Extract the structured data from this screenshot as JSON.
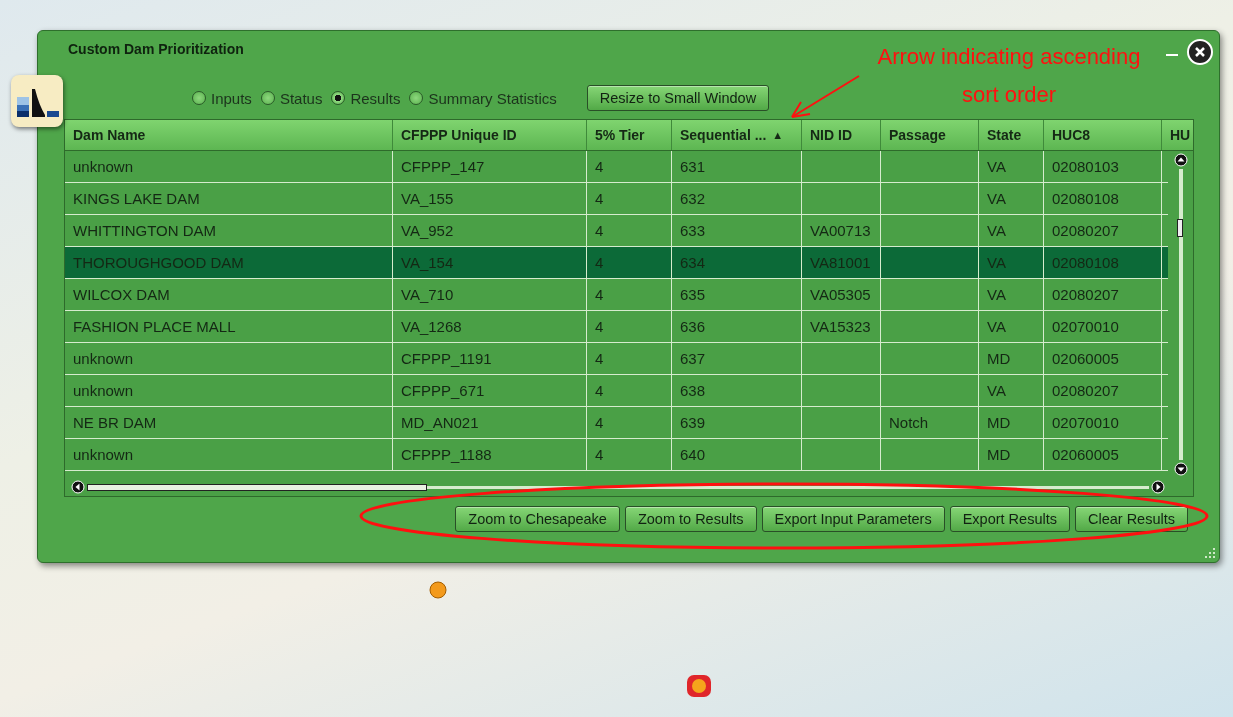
{
  "window": {
    "title": "Custom Dam Prioritization"
  },
  "views": [
    {
      "label": "Inputs",
      "selected": false
    },
    {
      "label": "Status",
      "selected": false
    },
    {
      "label": "Results",
      "selected": true
    },
    {
      "label": "Summary Statistics",
      "selected": false
    }
  ],
  "resize_button": "Resize to Small Window",
  "table": {
    "columns": [
      {
        "label": "Dam Name"
      },
      {
        "label": "CFPPP Unique ID"
      },
      {
        "label": "5% Tier"
      },
      {
        "label": "Sequential ...",
        "sort_indicator": "▲"
      },
      {
        "label": "NID ID"
      },
      {
        "label": "Passage"
      },
      {
        "label": "State"
      },
      {
        "label": "HUC8"
      },
      {
        "label": "HU"
      }
    ],
    "rows": [
      {
        "selected": false,
        "cells": {
          "dam_name": "unknown",
          "cfppp_id": "CFPPP_147",
          "tier": "4",
          "sequential": "631",
          "state": "VA",
          "huc8": "02080103"
        }
      },
      {
        "selected": false,
        "cells": {
          "dam_name": "KINGS LAKE DAM",
          "cfppp_id": "VA_155",
          "tier": "4",
          "sequential": "632",
          "state": "VA",
          "huc8": "02080108"
        }
      },
      {
        "selected": false,
        "cells": {
          "dam_name": "WHITTINGTON DAM",
          "cfppp_id": "VA_952",
          "tier": "4",
          "sequential": "633",
          "nid_id": "VA00713",
          "state": "VA",
          "huc8": "02080207"
        }
      },
      {
        "selected": true,
        "cells": {
          "dam_name": "THOROUGHGOOD DAM",
          "cfppp_id": "VA_154",
          "tier": "4",
          "sequential": "634",
          "nid_id": "VA81001",
          "state": "VA",
          "huc8": "02080108"
        }
      },
      {
        "selected": false,
        "cells": {
          "dam_name": "WILCOX DAM",
          "cfppp_id": "VA_710",
          "tier": "4",
          "sequential": "635",
          "nid_id": "VA05305",
          "state": "VA",
          "huc8": "02080207"
        }
      },
      {
        "selected": false,
        "cells": {
          "dam_name": "FASHION PLACE MALL",
          "cfppp_id": "VA_1268",
          "tier": "4",
          "sequential": "636",
          "nid_id": "VA15323",
          "state": "VA",
          "huc8": "02070010"
        }
      },
      {
        "selected": false,
        "cells": {
          "dam_name": "unknown",
          "cfppp_id": "CFPPP_1191",
          "tier": "4",
          "sequential": "637",
          "state": "MD",
          "huc8": "02060005"
        }
      },
      {
        "selected": false,
        "cells": {
          "dam_name": "unknown",
          "cfppp_id": "CFPPP_671",
          "tier": "4",
          "sequential": "638",
          "state": "VA",
          "huc8": "02080207"
        }
      },
      {
        "selected": false,
        "cells": {
          "dam_name": "NE BR DAM",
          "cfppp_id": "MD_AN021",
          "tier": "4",
          "sequential": "639",
          "passage": "Notch",
          "state": "MD",
          "huc8": "02070010"
        }
      },
      {
        "selected": false,
        "cells": {
          "dam_name": "unknown",
          "cfppp_id": "CFPPP_1188",
          "tier": "4",
          "sequential": "640",
          "state": "MD",
          "huc8": "02060005"
        }
      }
    ]
  },
  "buttons": [
    "Zoom to Chesapeake",
    "Zoom to Results",
    "Export Input Parameters",
    "Export Results",
    "Clear Results"
  ],
  "annotation": {
    "text": "Arrow indicating ascending sort order"
  }
}
